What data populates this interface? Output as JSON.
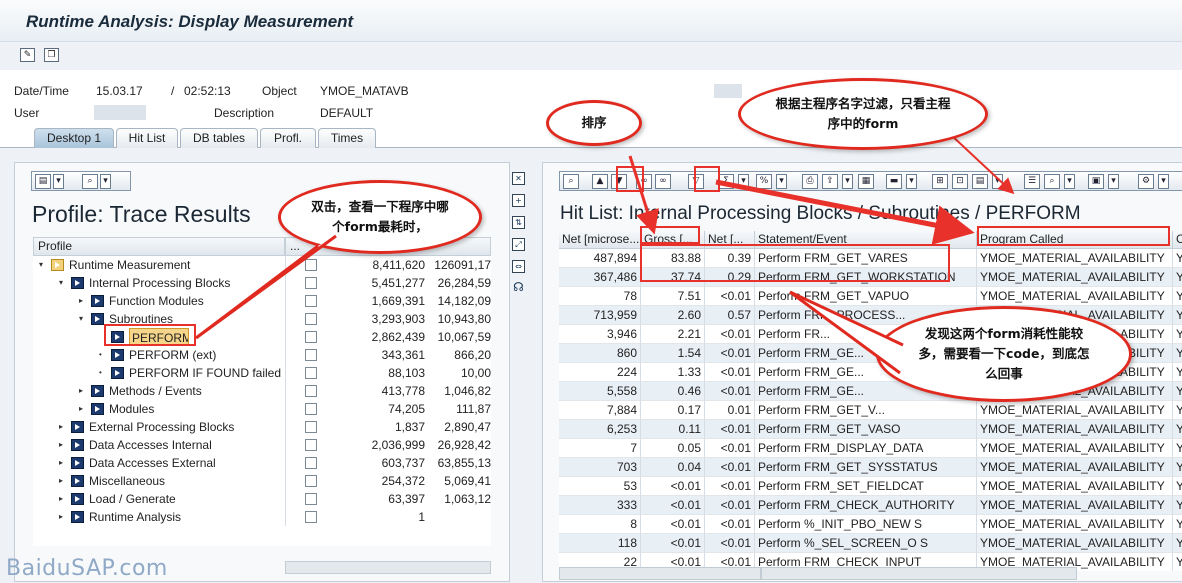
{
  "window": {
    "title": "Runtime Analysis: Display Measurement"
  },
  "header": {
    "datetime_label": "Date/Time",
    "date": "15.03.17",
    "sep": "/",
    "time": "02:52:13",
    "object_label": "Object",
    "object_value": "YMOE_MATAVB",
    "user_label": "User",
    "description_label": "Description",
    "description_value": "DEFAULT"
  },
  "tabs": [
    "Desktop 1",
    "Hit List",
    "DB tables",
    "Profl.",
    "Times"
  ],
  "left_panel": {
    "title": "Profile: Trace Results",
    "column_header": "Profile",
    "rows": [
      {
        "label": "Runtime Measurement",
        "v1": "8,411,620",
        "v2": "126091,17"
      },
      {
        "label": "Internal Processing Blocks",
        "v1": "5,451,277",
        "v2": "26,284,59"
      },
      {
        "label": "Function Modules",
        "v1": "1,669,391",
        "v2": "14,182,09"
      },
      {
        "label": "Subroutines",
        "v1": "3,293,903",
        "v2": "10,943,80"
      },
      {
        "label": "PERFORM",
        "v1": "2,862,439",
        "v2": "10,067,59"
      },
      {
        "label": "PERFORM (ext)",
        "v1": "343,361",
        "v2": "866,20"
      },
      {
        "label": "PERFORM IF FOUND failed",
        "v1": "88,103",
        "v2": "10,00"
      },
      {
        "label": "Methods / Events",
        "v1": "413,778",
        "v2": "1,046,82"
      },
      {
        "label": "Modules",
        "v1": "74,205",
        "v2": "111,87"
      },
      {
        "label": "External Processing Blocks",
        "v1": "1,837",
        "v2": "2,890,47"
      },
      {
        "label": "Data Accesses Internal",
        "v1": "2,036,999",
        "v2": "26,928,42"
      },
      {
        "label": "Data Accesses External",
        "v1": "603,737",
        "v2": "63,855,13"
      },
      {
        "label": "Miscellaneous",
        "v1": "254,372",
        "v2": "5,069,41"
      },
      {
        "label": "Load / Generate",
        "v1": "63,397",
        "v2": "1,063,12"
      },
      {
        "label": "Runtime Analysis",
        "v1": "1",
        "v2": ""
      }
    ]
  },
  "right_panel": {
    "title": "Hit List: Internal Processing Blocks / Subroutines / PERFORM",
    "columns": [
      "Net [microse...",
      "Gross [...",
      "Net [...",
      "Statement/Event",
      "Program Called",
      "C"
    ],
    "rows": [
      [
        "487,894",
        "83.88",
        "0.39",
        "Perform FRM_GET_VARES",
        "YMOE_MATERIAL_AVAILABILITY",
        "Y"
      ],
      [
        "367,486",
        "37.74",
        "0.29",
        "Perform FRM_GET_WORKSTATION",
        "YMOE_MATERIAL_AVAILABILITY",
        "Y"
      ],
      [
        "78",
        "7.51",
        "<0.01",
        "Perform FRM_GET_VAPUO",
        "YMOE_MATERIAL_AVAILABILITY",
        "Y"
      ],
      [
        "713,959",
        "2.60",
        "0.57",
        "Perform FRM_PROCESS...",
        "YMOE_MATERIAL_AVAILABILITY",
        "Y"
      ],
      [
        "3,946",
        "2.21",
        "<0.01",
        "Perform FR...",
        "YMOE_MATERIAL_AVAILABILITY",
        "Y"
      ],
      [
        "860",
        "1.54",
        "<0.01",
        "Perform FRM_GE...",
        "YMOE_MATERIAL_AVAILABILITY",
        "Y"
      ],
      [
        "224",
        "1.33",
        "<0.01",
        "Perform FRM_GE...",
        "YMOE_MATERIAL_AVAILABILITY",
        "Y"
      ],
      [
        "5,558",
        "0.46",
        "<0.01",
        "Perform FRM_GE...",
        "YMOE_MATERIAL_AVAILABILITY",
        "Y"
      ],
      [
        "7,884",
        "0.17",
        "0.01",
        "Perform FRM_GET_V...",
        "YMOE_MATERIAL_AVAILABILITY",
        "Y"
      ],
      [
        "6,253",
        "0.11",
        "<0.01",
        "Perform FRM_GET_VASO",
        "YMOE_MATERIAL_AVAILABILITY",
        "Y"
      ],
      [
        "7",
        "0.05",
        "<0.01",
        "Perform FRM_DISPLAY_DATA",
        "YMOE_MATERIAL_AVAILABILITY",
        "Y"
      ],
      [
        "703",
        "0.04",
        "<0.01",
        "Perform FRM_GET_SYSSTATUS",
        "YMOE_MATERIAL_AVAILABILITY",
        "Y"
      ],
      [
        "53",
        "<0.01",
        "<0.01",
        "Perform FRM_SET_FIELDCAT",
        "YMOE_MATERIAL_AVAILABILITY",
        "Y"
      ],
      [
        "333",
        "<0.01",
        "<0.01",
        "Perform FRM_CHECK_AUTHORITY",
        "YMOE_MATERIAL_AVAILABILITY",
        "Y"
      ],
      [
        "8",
        "<0.01",
        "<0.01",
        "Perform %_INIT_PBO_NEW S",
        "YMOE_MATERIAL_AVAILABILITY",
        "Y"
      ],
      [
        "118",
        "<0.01",
        "<0.01",
        "Perform %_SEL_SCREEN_O S",
        "YMOE_MATERIAL_AVAILABILITY",
        "Y"
      ],
      [
        "22",
        "<0.01",
        "<0.01",
        "Perform FRM_CHECK_INPUT",
        "YMOE_MATERIAL_AVAILABILITY",
        "Y"
      ]
    ]
  },
  "callouts": {
    "sort": "排序",
    "filter": "根据主程序名字过滤，只看主程序中的form",
    "double_click": "双击，查看一下程序中哪个form最耗时，",
    "found": "发现这两个form消耗性能较多，需要看一下code，到底怎么回事"
  },
  "watermark": "BaiduSAP.com",
  "colors": {
    "accent_red": "#e8312a",
    "selected": "#f5d58a",
    "row_alt": "#e8eff5"
  }
}
